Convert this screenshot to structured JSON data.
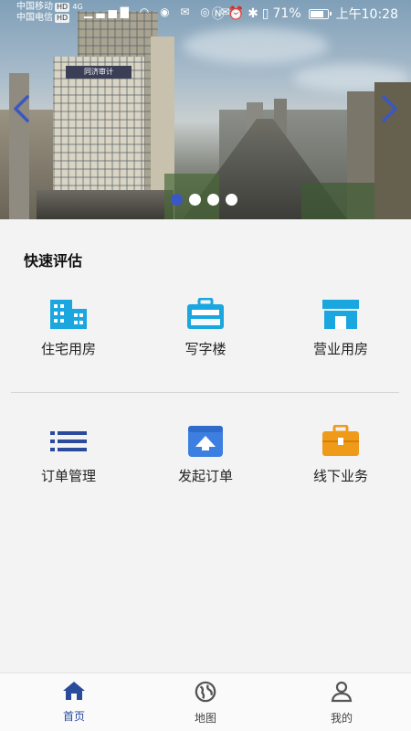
{
  "status_bar": {
    "carrier1": "中国移动",
    "carrier2": "中国电信",
    "hd": "HD",
    "network": "4G",
    "battery_pct": "71%",
    "time": "上午10:28"
  },
  "banner": {
    "slide_count": 4,
    "active_slide": 1,
    "building_sign_1": "同济审计",
    "accent_color": "#3b57c4"
  },
  "quick_eval": {
    "title": "快速评估",
    "row1": [
      {
        "label": "住宅用房",
        "icon": "residential-building-icon",
        "color": "#1aa6df"
      },
      {
        "label": "写字楼",
        "icon": "briefcase-icon",
        "color": "#1aa6df"
      },
      {
        "label": "营业用房",
        "icon": "storefront-icon",
        "color": "#1aa6df"
      }
    ],
    "row2": [
      {
        "label": "订单管理",
        "icon": "list-icon",
        "color": "#2a4a9c"
      },
      {
        "label": "发起订单",
        "icon": "upload-order-icon",
        "color": "#3d7fe0"
      },
      {
        "label": "线下业务",
        "icon": "toolbox-icon",
        "color": "#f09a1a"
      }
    ]
  },
  "bottom_nav": {
    "items": [
      {
        "label": "首页",
        "icon": "home-icon",
        "active": true
      },
      {
        "label": "地图",
        "icon": "globe-icon",
        "active": false
      },
      {
        "label": "我的",
        "icon": "user-icon",
        "active": false
      }
    ],
    "active_color": "#2a4a9c"
  }
}
